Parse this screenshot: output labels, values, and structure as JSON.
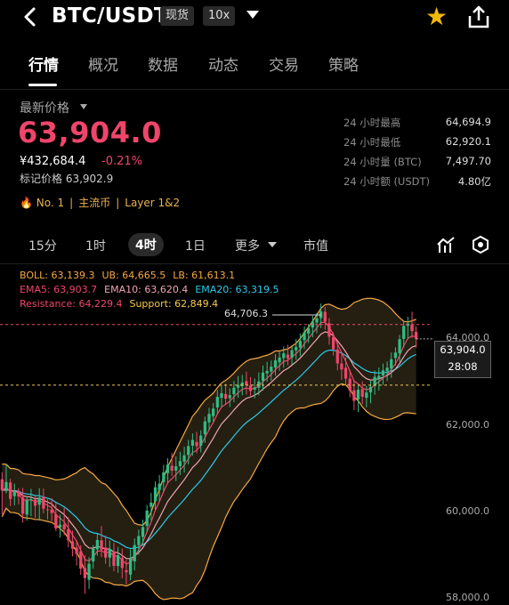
{
  "header": {
    "pair": "BTC/USDT",
    "spot_chip": "现货",
    "leverage_chip": "10x"
  },
  "tabs": [
    "行情",
    "概况",
    "数据",
    "动态",
    "交易",
    "策略"
  ],
  "price_block": {
    "label": "最新价格",
    "price": "63,904.0",
    "cny": "¥432,684.4",
    "change": "-0.21%",
    "mark_price": "标记价格 63,902.9",
    "rank": "No. 1",
    "tag1": "主流币",
    "tag2": "Layer 1&2"
  },
  "stats": [
    {
      "label": "24 小时最高",
      "value": "64,694.9"
    },
    {
      "label": "24 小时最低",
      "value": "62,920.1"
    },
    {
      "label": "24 小时量 (BTC)",
      "value": "7,497.70"
    },
    {
      "label": "24 小时额 (USDT)",
      "value": "4.80亿"
    }
  ],
  "intervals": [
    "15分",
    "1时",
    "4时",
    "1日",
    "更多",
    "市值"
  ],
  "chart": {
    "boll": "BOLL: 63,139.3",
    "ub": "UB: 64,665.5",
    "lb": "LB: 61,613.1",
    "ema5": "EMA5: 63,903.7",
    "ema10": "EMA10: 63,620.4",
    "ema20": "EMA20: 63,319.5",
    "resistance": "Resistance: 64,229.4",
    "support": "Support: 62,849.4",
    "high_marker": "64,706.3",
    "current_price": "63,904.0",
    "countdown": "28:08",
    "y_ticks": [
      "64,000.0",
      "62,000.0",
      "60,000.0",
      "58,000.0"
    ],
    "colors": {
      "up": "#2ebd85",
      "down": "#f0456b",
      "boll": "#f7a844",
      "ema5": "#f0456b",
      "ema10": "#f0a3b5",
      "ema20": "#2cc9e8",
      "resistance": "#f0456b",
      "support": "#f7c94a"
    }
  },
  "chart_data": {
    "type": "candlestick",
    "interval": "4h",
    "y_ticks": [
      64000,
      62000,
      60000,
      58000
    ],
    "ylim": [
      57850,
      65600
    ],
    "resistance": 64229.4,
    "support": 62849.4,
    "candles": [
      [
        60710,
        60865,
        59905,
        60455
      ],
      [
        60441,
        61056,
        60390,
        60649
      ],
      [
        60636,
        60719,
        60100,
        60264
      ],
      [
        60327,
        60609,
        60116,
        60434
      ],
      [
        60434,
        60507,
        60139,
        60316
      ],
      [
        60297,
        60513,
        59722,
        59926
      ],
      [
        59907,
        60301,
        59768,
        60234
      ],
      [
        60234,
        60493,
        59870,
        60256
      ],
      [
        60246,
        60333,
        59832,
        60107
      ],
      [
        60130,
        60507,
        59768,
        60293
      ],
      [
        60311,
        60497,
        59935,
        60041
      ],
      [
        60026,
        60255,
        59794,
        60018
      ],
      [
        60019,
        60279,
        59758,
        59941
      ],
      [
        59911,
        60173,
        59528,
        59591
      ],
      [
        59614,
        59901,
        59380,
        59675
      ],
      [
        59680,
        60057,
        59440,
        59573
      ],
      [
        59573,
        59849,
        59158,
        59321
      ],
      [
        59297,
        59540,
        58959,
        59128
      ],
      [
        59155,
        59328,
        58748,
        59013
      ],
      [
        59071,
        59210,
        58538,
        58676
      ],
      [
        58691,
        58984,
        58106,
        58463
      ],
      [
        58423,
        58940,
        58213,
        58789
      ],
      [
        58840,
        59211,
        58673,
        59130
      ],
      [
        59115,
        59469,
        58974,
        59328
      ],
      [
        59322,
        59646,
        58942,
        59107
      ],
      [
        59157,
        59429,
        58787,
        58929
      ],
      [
        58928,
        59316,
        58713,
        59125
      ],
      [
        59067,
        59264,
        58617,
        58740
      ],
      [
        58737,
        59173,
        58580,
        58982
      ],
      [
        58920,
        59132,
        58454,
        58693
      ],
      [
        58638,
        58880,
        58316,
        58595
      ],
      [
        58542,
        59115,
        58413,
        58902
      ],
      [
        58843,
        59363,
        58640,
        59214
      ],
      [
        59208,
        59567,
        58999,
        59418
      ],
      [
        59398,
        59792,
        59216,
        59622
      ],
      [
        59649,
        60124,
        59509,
        59997
      ],
      [
        60082,
        60398,
        59777,
        60180
      ],
      [
        60208,
        60660,
        60016,
        60526
      ],
      [
        60465,
        60808,
        60198,
        60610
      ],
      [
        60645,
        61039,
        60429,
        60864
      ],
      [
        60849,
        61189,
        60624,
        61042
      ],
      [
        61017,
        61310,
        60789,
        60908
      ],
      [
        60907,
        61230,
        60667,
        61006
      ],
      [
        61008,
        61337,
        60803,
        61122
      ],
      [
        61111,
        61450,
        60862,
        61255
      ],
      [
        61261,
        61607,
        61047,
        61465
      ],
      [
        61473,
        61753,
        61244,
        61605
      ],
      [
        61557,
        61788,
        61299,
        61463
      ],
      [
        61472,
        61822,
        61322,
        61702
      ],
      [
        61732,
        62137,
        61536,
        62025
      ],
      [
        62001,
        62334,
        61827,
        62198
      ],
      [
        62145,
        62444,
        62015,
        62318
      ],
      [
        62343,
        62738,
        62192,
        62584
      ],
      [
        62561,
        62850,
        62345,
        62667
      ],
      [
        62649,
        62879,
        62413,
        62544
      ],
      [
        62554,
        62780,
        62353,
        62623
      ],
      [
        62644,
        62946,
        62461,
        62792
      ],
      [
        62794,
        63057,
        62562,
        62856
      ],
      [
        62826,
        63084,
        62620,
        62909
      ],
      [
        62941,
        63156,
        62636,
        62853
      ],
      [
        62843,
        63036,
        62607,
        62715
      ],
      [
        62750,
        63000,
        62551,
        62797
      ],
      [
        62792,
        63140,
        62617,
        62936
      ],
      [
        62947,
        63297,
        62725,
        63135
      ],
      [
        63120,
        63380,
        62929,
        63172
      ],
      [
        63162,
        63410,
        62952,
        63271
      ],
      [
        63252,
        63555,
        63066,
        63417
      ],
      [
        63370,
        63624,
        63174,
        63477
      ],
      [
        63465,
        63728,
        63246,
        63573
      ],
      [
        63545,
        63769,
        63303,
        63460
      ],
      [
        63479,
        63764,
        63311,
        63645
      ],
      [
        63640,
        63895,
        63429,
        63715
      ],
      [
        63704,
        64025,
        63506,
        63853
      ],
      [
        63873,
        64183,
        63673,
        64054
      ],
      [
        64024,
        64244,
        63808,
        64142
      ],
      [
        64160,
        64427,
        63938,
        64295
      ],
      [
        64275,
        64493,
        64030,
        64367
      ],
      [
        64376,
        64706,
        64149,
        64529
      ],
      [
        64518,
        64628,
        64112,
        64297
      ],
      [
        64258,
        64376,
        63770,
        63950
      ],
      [
        63948,
        64052,
        63521,
        63666
      ],
      [
        63660,
        63833,
        63187,
        63345
      ],
      [
        63343,
        63569,
        62970,
        63205
      ],
      [
        63245,
        63480,
        62856,
        62998
      ],
      [
        62998,
        63202,
        62573,
        62723
      ],
      [
        62733,
        62971,
        62281,
        62493
      ],
      [
        62526,
        62839,
        62238,
        62746
      ],
      [
        62758,
        62934,
        62419,
        62587
      ],
      [
        62562,
        62834,
        62347,
        62682
      ],
      [
        62687,
        62947,
        62436,
        62814
      ],
      [
        62836,
        63187,
        62632,
        63039
      ],
      [
        63007,
        63253,
        62728,
        63063
      ],
      [
        63071,
        63340,
        62855,
        63186
      ],
      [
        63168,
        63393,
        62943,
        63247
      ],
      [
        63226,
        63591,
        63015,
        63440
      ],
      [
        63469,
        63711,
        63297,
        63591
      ],
      [
        63576,
        63990,
        63381,
        63895
      ],
      [
        63902,
        64305,
        63704,
        64195
      ],
      [
        64201,
        64412,
        63908,
        64249
      ],
      [
        64227,
        64520,
        63929,
        64081
      ],
      [
        64060,
        64183,
        63704,
        63904
      ]
    ],
    "boll_mid_approx": 63139.3,
    "boll_ub_latest": 64665.5,
    "boll_lb_latest": 61613.1,
    "ema5_latest": 63903.7,
    "ema10_latest": 63620.4,
    "ema20_latest": 63319.5
  }
}
